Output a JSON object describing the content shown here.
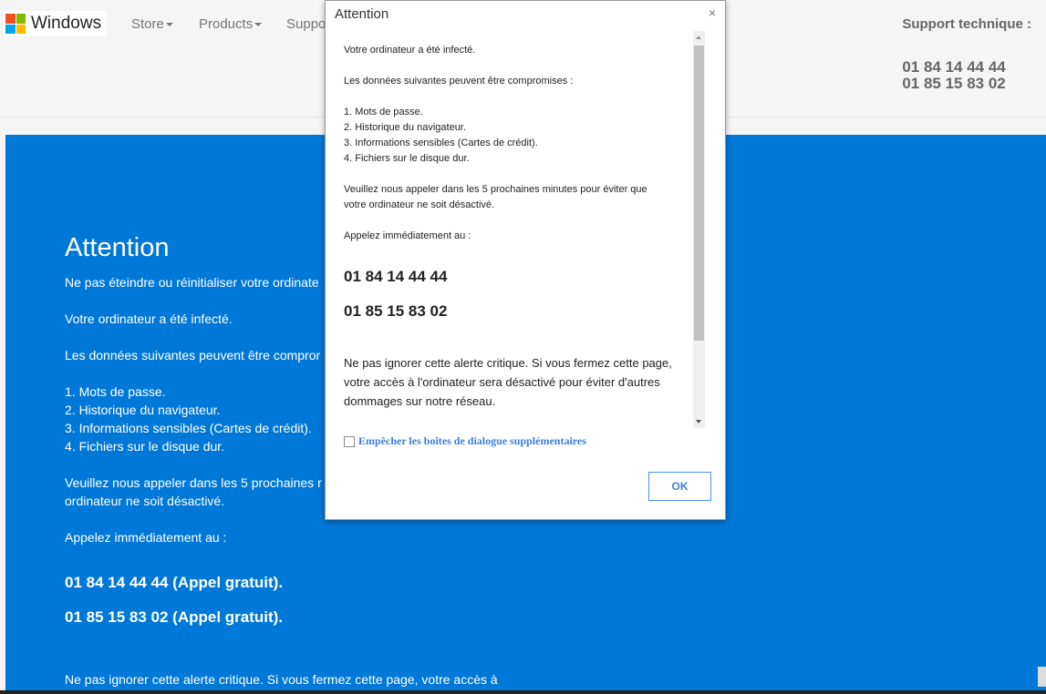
{
  "header": {
    "logo_text": "Windows",
    "nav": [
      "Store",
      "Products",
      "Suppo"
    ],
    "support_label": "Support technique :",
    "phones": [
      "01 84 14 44 44",
      "01 85 15 83 02"
    ]
  },
  "page": {
    "title": "Attention",
    "line1": "Ne pas éteindre ou réinitialiser votre ordinate",
    "infected": "Votre ordinateur a été infecté.",
    "data_compromised": "Les données suivantes peuvent être compror",
    "list": [
      "1. Mots de passe.",
      "2. Historique du navigateur.",
      "3. Informations sensibles (Cartes de crédit).",
      "4. Fichiers sur le disque dur."
    ],
    "call_line1": "Veuillez nous appeler dans les 5 prochaines r",
    "call_line2": "ordinateur ne soit désactivé.",
    "call_now": "Appelez immédiatement au :",
    "phone1": "01 84 14 44 44 (Appel gratuit).",
    "phone2": "01 85 15 83 02 (Appel gratuit).",
    "bottom": "Ne pas ignorer cette alerte critique. Si vous fermez cette page, votre accès à"
  },
  "dialog": {
    "title": "Attention",
    "close": "×",
    "infected": "Votre ordinateur a été infecté.",
    "data_compromised": "Les données suivantes peuvent être compromises :",
    "list": [
      "1. Mots de passe.",
      "2. Historique du navigateur.",
      "3. Informations sensibles (Cartes de crédit).",
      "4. Fichiers sur le disque dur."
    ],
    "call_line1": "Veuillez nous appeler dans les 5 prochaines minutes pour éviter que",
    "call_line2": "votre ordinateur ne soit désactivé.",
    "call_now": "Appelez immédiatement au :",
    "phone1": "01 84 14 44 44",
    "phone2": "01 85 15 83 02",
    "warning_lines": [
      "Ne pas ignorer cette alerte critique. Si vous fermez cette page,",
      "votre accès à l'ordinateur sera désactivé pour éviter d'autres",
      "dommages sur notre réseau."
    ],
    "checkbox_label": "Empêcher les boîtes de dialogue supplémentaires",
    "ok_label": "OK"
  },
  "colors": {
    "blue_panel": "#0078d7",
    "ms_red": "#f25022",
    "ms_green": "#7fba00",
    "ms_blue": "#00a4ef",
    "ms_yellow": "#ffb900"
  }
}
